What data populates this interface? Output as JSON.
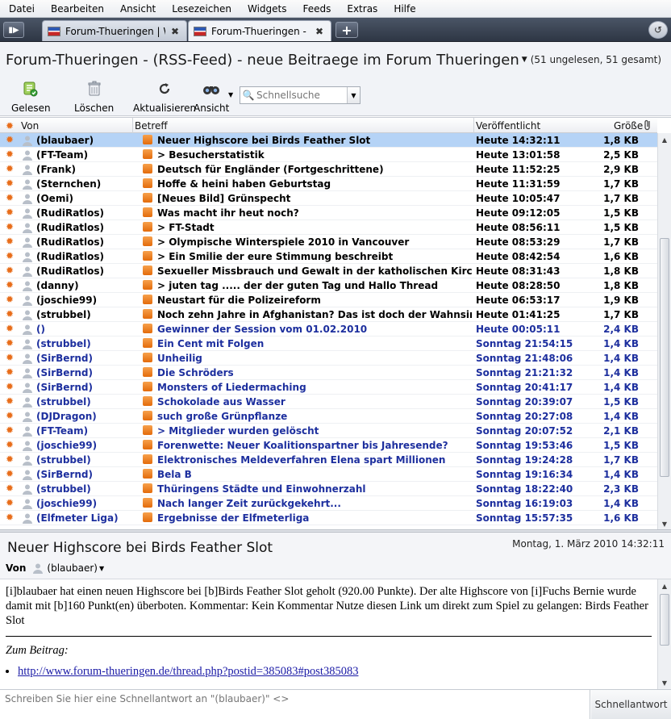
{
  "menu": [
    "Datei",
    "Bearbeiten",
    "Ansicht",
    "Lesezeichen",
    "Widgets",
    "Feeds",
    "Extras",
    "Hilfe"
  ],
  "tabs": [
    {
      "label": "Forum-Thueringen | W...",
      "active": false
    },
    {
      "label": "Forum-Thueringen - (...",
      "active": true
    }
  ],
  "header": {
    "title": "Forum-Thueringen - (RSS-Feed) - neue Beitraege im Forum Thueringen",
    "count": "(51 ungelesen, 51 gesamt)"
  },
  "toolbar": {
    "read": "Gelesen",
    "delete": "Löschen",
    "refresh": "Aktualisieren",
    "view": "Ansicht",
    "search_placeholder": "Schnellsuche"
  },
  "columns": {
    "from": "Von",
    "subject": "Betreff",
    "published": "Veröffentlicht",
    "size": "Größe"
  },
  "messages": [
    {
      "from": "(blaubaer)",
      "subject": "Neuer Highscore bei Birds Feather Slot",
      "date": "Heute 14:32:11",
      "size": "1,8 KB"
    },
    {
      "from": "(FT-Team)",
      "subject": "> Besucherstatistik",
      "date": "Heute 13:01:58",
      "size": "2,5 KB"
    },
    {
      "from": "(Frank)",
      "subject": "Deutsch für Engländer (Fortgeschrittene)",
      "date": "Heute 11:52:25",
      "size": "2,9 KB"
    },
    {
      "from": "(Sternchen)",
      "subject": "Hoffe & heini haben Geburtstag",
      "date": "Heute 11:31:59",
      "size": "1,7 KB"
    },
    {
      "from": "(Oemi)",
      "subject": "[Neues Bild] Grünspecht",
      "date": "Heute 10:05:47",
      "size": "1,7 KB"
    },
    {
      "from": "(RudiRatlos)",
      "subject": "Was macht ihr heut noch?",
      "date": "Heute 09:12:05",
      "size": "1,5 KB"
    },
    {
      "from": "(RudiRatlos)",
      "subject": "> FT-Stadt",
      "date": "Heute 08:56:11",
      "size": "1,5 KB"
    },
    {
      "from": "(RudiRatlos)",
      "subject": "> Olympische Winterspiele 2010 in Vancouver",
      "date": "Heute 08:53:29",
      "size": "1,7 KB"
    },
    {
      "from": "(RudiRatlos)",
      "subject": "> Ein Smilie der eure Stimmung beschreibt",
      "date": "Heute 08:42:54",
      "size": "1,6 KB"
    },
    {
      "from": "(RudiRatlos)",
      "subject": "Sexueller Missbrauch und Gewalt in der katholischen Kirche",
      "date": "Heute 08:31:43",
      "size": "1,8 KB"
    },
    {
      "from": "(danny)",
      "subject": "> juten tag ..... der der guten Tag und Hallo Thread",
      "date": "Heute 08:28:50",
      "size": "1,8 KB"
    },
    {
      "from": "(joschie99)",
      "subject": "Neustart für die Polizeireform",
      "date": "Heute 06:53:17",
      "size": "1,9 KB"
    },
    {
      "from": "(strubbel)",
      "subject": "Noch zehn Jahre in Afghanistan? Das ist doch der Wahnsinn.",
      "date": "Heute 01:41:25",
      "size": "1,7 KB"
    },
    {
      "from": "()",
      "subject": "Gewinner der Session vom 01.02.2010",
      "date": "Heute 00:05:11",
      "size": "2,4 KB"
    },
    {
      "from": "(strubbel)",
      "subject": "Ein Cent mit Folgen",
      "date": "Sonntag 21:54:15",
      "size": "1,4 KB"
    },
    {
      "from": "(SirBernd)",
      "subject": "Unheilig",
      "date": "Sonntag 21:48:06",
      "size": "1,4 KB"
    },
    {
      "from": "(SirBernd)",
      "subject": "Die Schröders",
      "date": "Sonntag 21:21:32",
      "size": "1,4 KB"
    },
    {
      "from": "(SirBernd)",
      "subject": "Monsters of Liedermaching",
      "date": "Sonntag 20:41:17",
      "size": "1,4 KB"
    },
    {
      "from": "(strubbel)",
      "subject": "Schokolade aus Wasser",
      "date": "Sonntag 20:39:07",
      "size": "1,5 KB"
    },
    {
      "from": "(DJDragon)",
      "subject": "such große Grünpflanze",
      "date": "Sonntag 20:27:08",
      "size": "1,4 KB"
    },
    {
      "from": "(FT-Team)",
      "subject": "> Mitglieder wurden gelöscht",
      "date": "Sonntag 20:07:52",
      "size": "2,1 KB"
    },
    {
      "from": "(joschie99)",
      "subject": "Forenwette: Neuer Koalitionspartner bis Jahresende?",
      "date": "Sonntag 19:53:46",
      "size": "1,5 KB"
    },
    {
      "from": "(strubbel)",
      "subject": "Elektronisches Meldeverfahren Elena spart Millionen",
      "date": "Sonntag 19:24:28",
      "size": "1,7 KB"
    },
    {
      "from": "(SirBernd)",
      "subject": "Bela B",
      "date": "Sonntag 19:16:34",
      "size": "1,4 KB"
    },
    {
      "from": "(strubbel)",
      "subject": "Thüringens Städte und Einwohnerzahl",
      "date": "Sonntag 18:22:40",
      "size": "2,3 KB"
    },
    {
      "from": "(joschie99)",
      "subject": "Nach langer Zeit zurückgekehrt...",
      "date": "Sonntag 16:19:03",
      "size": "1,4 KB"
    },
    {
      "from": "(Elfmeter Liga)",
      "subject": "Ergebnisse der Elfmeterliga",
      "date": "Sonntag 15:57:35",
      "size": "1,6 KB"
    }
  ],
  "preview": {
    "title": "Neuer Highscore bei Birds Feather Slot",
    "date": "Montag, 1. März 2010 14:32:11",
    "from_label": "Von",
    "from": "(blaubaer)",
    "body": "[i]blaubaer hat einen neuen Highscore bei [b]Birds Feather Slot geholt (920.00 Punkte). Der alte Highscore von [i]Fuchs Bernie wurde damit mit [b]160 Punkt(en) überboten. Kommentar: Kein Kommentar Nutze diesen Link um direkt zum Spiel zu gelangen: Birds Feather Slot",
    "zum_label": "Zum Beitrag:",
    "link": "http://www.forum-thueringen.de/thread.php?postid=385083#post385083"
  },
  "reply": {
    "placeholder": "Schreiben Sie hier eine Schnellantwort an \"(blaubaer)\" <>",
    "button": "Schnellantwort"
  },
  "colors": {
    "accent_blue": "#1d2f9e",
    "selection": "#b5d3f6",
    "rss_orange": "#e86d1a"
  }
}
